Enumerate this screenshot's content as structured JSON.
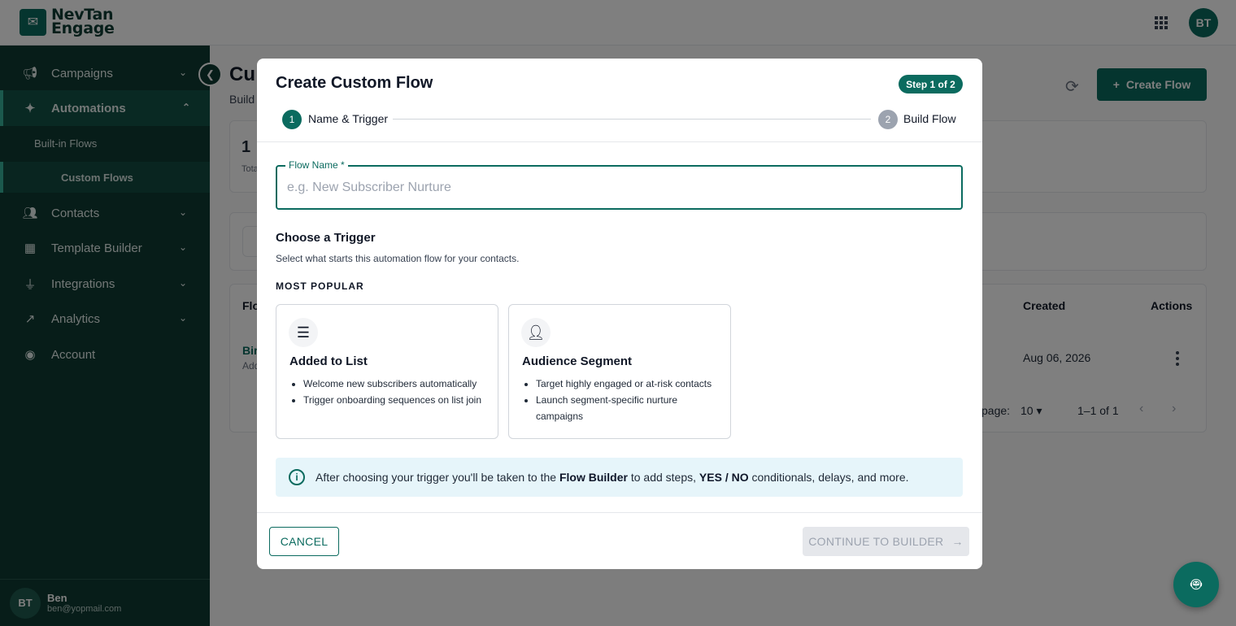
{
  "app": {
    "brand_line1": "NevTan",
    "brand_line2": "Engage",
    "user_initials": "BT"
  },
  "sidebar": {
    "items": [
      {
        "label": "Campaigns",
        "icon": "megaphone-icon"
      },
      {
        "label": "Automations",
        "icon": "sparkle-icon",
        "active": true
      },
      {
        "label": "Contacts",
        "icon": "people-icon"
      },
      {
        "label": "Template Builder",
        "icon": "grid-icon"
      },
      {
        "label": "Integrations",
        "icon": "plug-icon"
      },
      {
        "label": "Analytics",
        "icon": "trend-icon"
      },
      {
        "label": "Account",
        "icon": "user-circle-icon"
      }
    ],
    "sub_items": [
      {
        "label": "Built-in Flows"
      },
      {
        "label": "Custom Flows",
        "active": true
      }
    ],
    "user": {
      "initials": "BT",
      "name": "Ben",
      "email": "ben@yopmail.com"
    }
  },
  "main": {
    "title_partial": "Cu",
    "subtitle_partial": "Build",
    "create_button": "Create Flow",
    "stat_value": "1",
    "stat_label_partial": "Tota",
    "table": {
      "col_flow_partial": "Flo",
      "col_created": "Created",
      "col_actions": "Actions",
      "row_name_partial": "Bir",
      "row_sub_partial": "Add",
      "row_created": "Aug 06, 2026"
    },
    "pagination": {
      "rows_label_partial": "page:",
      "rows_value": "10",
      "range": "1–1 of 1"
    }
  },
  "modal": {
    "title": "Create Custom Flow",
    "step_badge": "Step 1 of 2",
    "steps": [
      {
        "num": "1",
        "label": "Name & Trigger"
      },
      {
        "num": "2",
        "label": "Build Flow"
      }
    ],
    "field_label": "Flow Name *",
    "field_placeholder": "e.g. New Subscriber Nurture",
    "field_value": "",
    "section_title": "Choose a Trigger",
    "section_subtitle": "Select what starts this automation flow for your contacts.",
    "popular_label": "MOST POPULAR",
    "triggers": [
      {
        "title": "Added to List",
        "icon": "list-icon",
        "bullets": [
          "Welcome new subscribers automatically",
          "Trigger onboarding sequences on list join"
        ]
      },
      {
        "title": "Audience Segment",
        "icon": "add-user-icon",
        "bullets": [
          "Target highly engaged or at-risk contacts",
          "Launch segment-specific nurture campaigns"
        ]
      }
    ],
    "info": {
      "part1": "After choosing your trigger you'll be taken to the ",
      "bold1": "Flow Builder",
      "part2": " to add steps, ",
      "bold2": "YES / NO",
      "part3": " conditionals, delays, and more."
    },
    "cancel_label": "CANCEL",
    "continue_label": "CONTINUE TO BUILDER"
  },
  "colors": {
    "brand": "#0b6b5f",
    "sidebar_bg": "#0e3b32",
    "info_bg": "#e6f5fa"
  }
}
